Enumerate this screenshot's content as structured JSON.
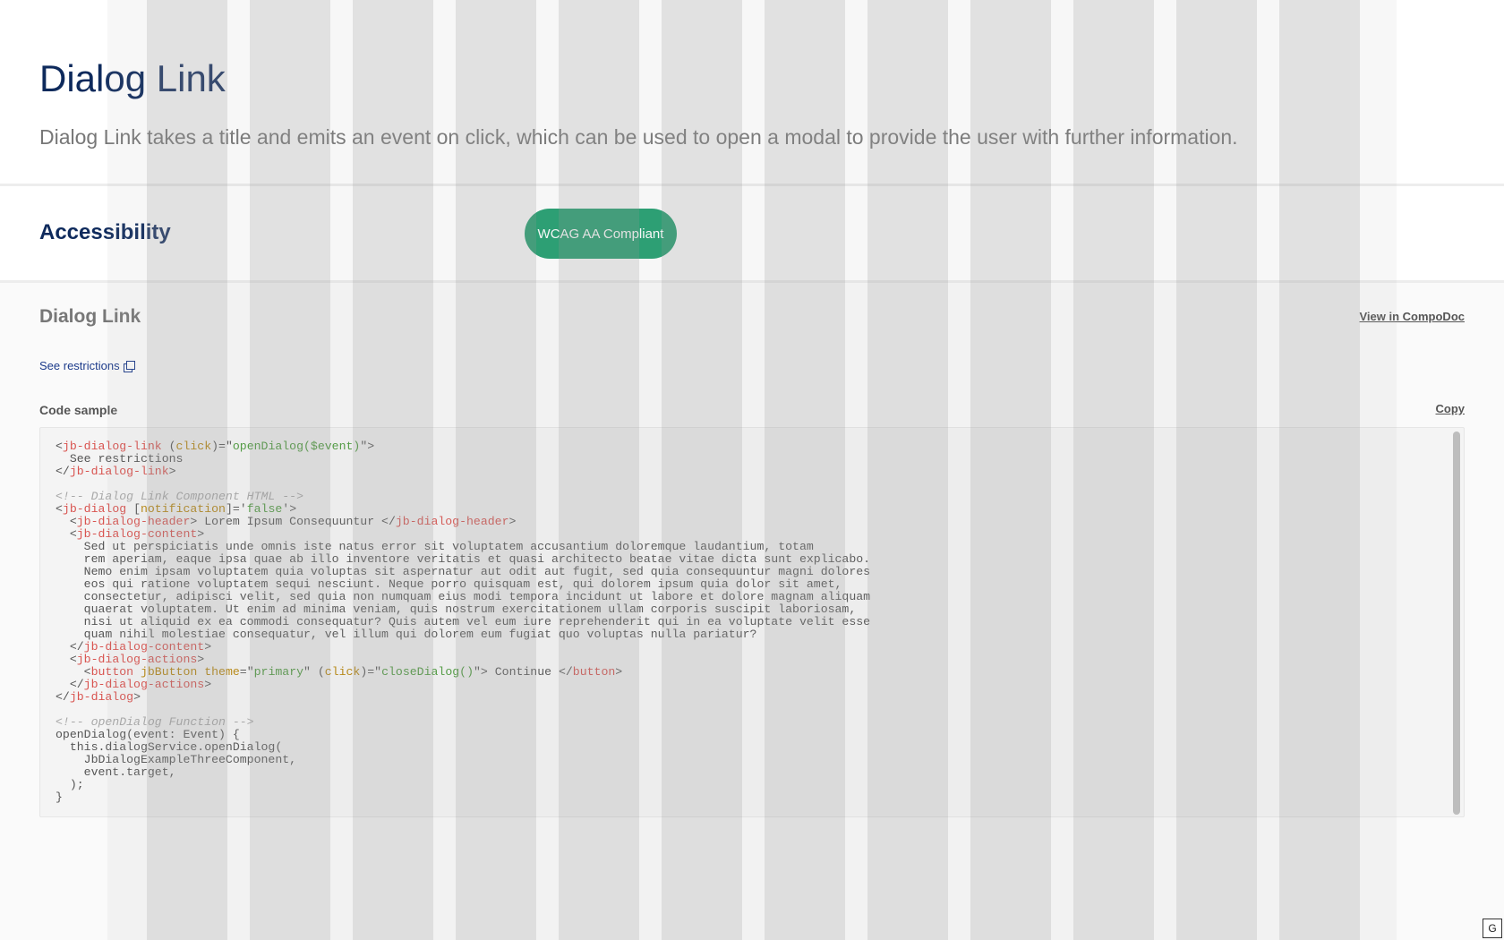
{
  "header": {
    "title_part1": "Dialog",
    "title_part2": "Link",
    "description": "Dialog Link takes a title and emits an event on click, which can be used to open a modal to provide the user with further information."
  },
  "accessibility": {
    "title": "Accessibility",
    "badge": "WCAG AA Compliant"
  },
  "component": {
    "title": "Dialog Link",
    "compodoc_link": "View in CompoDoc",
    "restrictions_link": "See restrictions",
    "code_label": "Code sample",
    "copy_label": "Copy"
  },
  "code_lines": [
    [
      [
        "pn",
        "<"
      ],
      [
        "tag",
        "jb-dialog-link"
      ],
      [
        "pn",
        " ("
      ],
      [
        "attr",
        "click"
      ],
      [
        "pn",
        ")=\""
      ],
      [
        "str",
        "openDialog($event)"
      ],
      [
        "pn",
        "\">"
      ]
    ],
    [
      [
        "pn",
        "  See restrictions"
      ]
    ],
    [
      [
        "pn",
        "</"
      ],
      [
        "tag",
        "jb-dialog-link"
      ],
      [
        "pn",
        ">"
      ]
    ],
    [
      [
        "pn",
        ""
      ]
    ],
    [
      [
        "com",
        "<!-- Dialog Link Component HTML -->"
      ]
    ],
    [
      [
        "pn",
        "<"
      ],
      [
        "tag",
        "jb-dialog"
      ],
      [
        "pn",
        " ["
      ],
      [
        "attr",
        "notification"
      ],
      [
        "pn",
        "]='"
      ],
      [
        "str",
        "false"
      ],
      [
        "pn",
        "'>"
      ]
    ],
    [
      [
        "pn",
        "  <"
      ],
      [
        "tag",
        "jb-dialog-header"
      ],
      [
        "pn",
        "> Lorem Ipsum Consequuntur </"
      ],
      [
        "tag",
        "jb-dialog-header"
      ],
      [
        "pn",
        ">"
      ]
    ],
    [
      [
        "pn",
        "  <"
      ],
      [
        "tag",
        "jb-dialog-content"
      ],
      [
        "pn",
        ">"
      ]
    ],
    [
      [
        "pn",
        "    Sed ut perspiciatis unde omnis iste natus error sit voluptatem accusantium doloremque laudantium, totam"
      ]
    ],
    [
      [
        "pn",
        "    rem aperiam, eaque ipsa quae ab illo inventore veritatis et quasi architecto beatae vitae dicta sunt explicabo."
      ]
    ],
    [
      [
        "pn",
        "    Nemo enim ipsam voluptatem quia voluptas sit aspernatur aut odit aut fugit, sed quia consequuntur magni dolores"
      ]
    ],
    [
      [
        "pn",
        "    eos qui ratione voluptatem sequi nesciunt. Neque porro quisquam est, qui dolorem ipsum quia dolor sit amet,"
      ]
    ],
    [
      [
        "pn",
        "    consectetur, adipisci velit, sed quia non numquam eius modi tempora incidunt ut labore et dolore magnam aliquam"
      ]
    ],
    [
      [
        "pn",
        "    quaerat voluptatem. Ut enim ad minima veniam, quis nostrum exercitationem ullam corporis suscipit laboriosam,"
      ]
    ],
    [
      [
        "pn",
        "    nisi ut aliquid ex ea commodi consequatur? Quis autem vel eum iure reprehenderit qui in ea voluptate velit esse"
      ]
    ],
    [
      [
        "pn",
        "    quam nihil molestiae consequatur, vel illum qui dolorem eum fugiat quo voluptas nulla pariatur?"
      ]
    ],
    [
      [
        "pn",
        "  </"
      ],
      [
        "tag",
        "jb-dialog-content"
      ],
      [
        "pn",
        ">"
      ]
    ],
    [
      [
        "pn",
        "  <"
      ],
      [
        "tag",
        "jb-dialog-actions"
      ],
      [
        "pn",
        ">"
      ]
    ],
    [
      [
        "pn",
        "    <"
      ],
      [
        "tag",
        "button"
      ],
      [
        "pn",
        " "
      ],
      [
        "attr",
        "jbButton"
      ],
      [
        "pn",
        " "
      ],
      [
        "attr",
        "theme"
      ],
      [
        "pn",
        "=\""
      ],
      [
        "str",
        "primary"
      ],
      [
        "pn",
        "\" ("
      ],
      [
        "attr",
        "click"
      ],
      [
        "pn",
        ")=\""
      ],
      [
        "str",
        "closeDialog()"
      ],
      [
        "pn",
        "\"> Continue </"
      ],
      [
        "tag",
        "button"
      ],
      [
        "pn",
        ">"
      ]
    ],
    [
      [
        "pn",
        "  </"
      ],
      [
        "tag",
        "jb-dialog-actions"
      ],
      [
        "pn",
        ">"
      ]
    ],
    [
      [
        "pn",
        "</"
      ],
      [
        "tag",
        "jb-dialog"
      ],
      [
        "pn",
        ">"
      ]
    ],
    [
      [
        "pn",
        ""
      ]
    ],
    [
      [
        "com",
        "<!-- openDialog Function -->"
      ]
    ],
    [
      [
        "pn",
        "openDialog(event: Event) {"
      ]
    ],
    [
      [
        "pn",
        "  this.dialogService.openDialog("
      ]
    ],
    [
      [
        "pn",
        "    JbDialogExampleThreeComponent,"
      ]
    ],
    [
      [
        "pn",
        "    event.target,"
      ]
    ],
    [
      [
        "pn",
        "  );"
      ]
    ],
    [
      [
        "pn",
        "}"
      ]
    ]
  ],
  "corner_badge": "G"
}
